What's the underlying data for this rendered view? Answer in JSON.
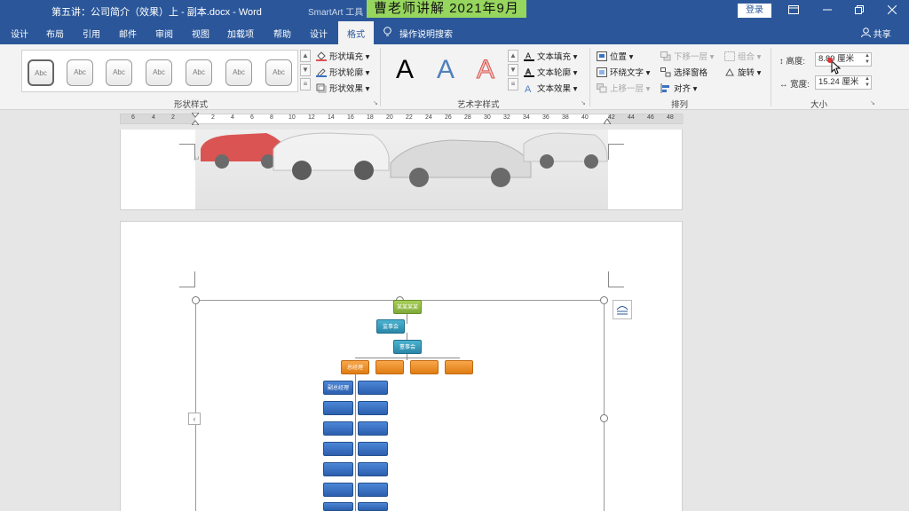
{
  "titlebar": {
    "doc_title": "第五讲：公司简介（效果）上 - 副本.docx  -  Word",
    "contextual": "SmartArt 工具",
    "banner": "曹老师讲解    2021年9月",
    "login": "登录",
    "win_icons": [
      "ribbon-display-icon",
      "minimize-icon",
      "restore-icon",
      "close-icon"
    ]
  },
  "tabs": [
    "设计",
    "布局",
    "引用",
    "邮件",
    "审阅",
    "视图",
    "加载项",
    "帮助",
    "设计",
    "格式"
  ],
  "active_tab": "格式",
  "tellme": "操作说明搜索",
  "share": "共享",
  "shape_styles": {
    "buttons": [
      "Abc",
      "Abc",
      "Abc",
      "Abc",
      "Abc",
      "Abc",
      "Abc"
    ],
    "fill": "形状填充",
    "outline": "形状轮廓",
    "effects": "形状效果",
    "label": "形状样式"
  },
  "wordart_styles": {
    "letters": [
      "A",
      "A",
      "A"
    ],
    "text_fill": "文本填充",
    "text_outline": "文本轮廓",
    "text_effects": "文本效果",
    "label": "艺术字样式"
  },
  "arrange": {
    "position": "位置",
    "wrap_text": "环绕文字",
    "bring_forward": "上移一层",
    "send_backward": "下移一层",
    "selection_pane": "选择窗格",
    "align": "对齐",
    "group": "组合",
    "rotate": "旋转",
    "label": "排列"
  },
  "size": {
    "height_label": "高度:",
    "height_value": "8.89 厘米",
    "width_label": "宽度:",
    "width_value": "15.24 厘米",
    "label": "大小"
  },
  "ruler": {
    "numbers": [
      "6",
      "4",
      "2",
      "2",
      "4",
      "6",
      "8",
      "10",
      "12",
      "14",
      "16",
      "18",
      "20",
      "22",
      "24",
      "26",
      "28",
      "30",
      "32",
      "34",
      "36",
      "38",
      "40",
      "42",
      "44",
      "46",
      "48"
    ]
  },
  "smartart": {
    "top": "某某某某",
    "assistant": "监事会",
    "board": "董事会",
    "manager": "总经理",
    "dept_head": "副总经理"
  },
  "colors": {
    "word_blue": "#2b579a",
    "banner_green": "#96d65e",
    "node_green": "#8cb845",
    "node_teal": "#3399bb",
    "node_orange": "#f0901f",
    "node_blue": "#3a72c4"
  }
}
